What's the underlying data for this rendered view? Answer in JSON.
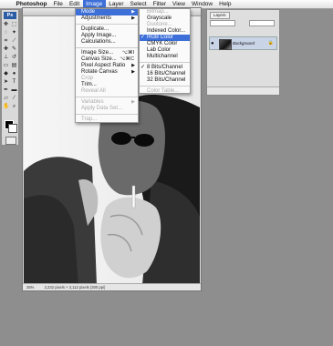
{
  "menubar": {
    "app": "Photoshop",
    "items": [
      "File",
      "Edit",
      "Image",
      "Layer",
      "Select",
      "Filter",
      "View",
      "Window",
      "Help"
    ],
    "active_item": "Image"
  },
  "tools_panel": {
    "logo": "Ps"
  },
  "image_menu": {
    "items": [
      {
        "label": "Mode",
        "submenu": true,
        "highlighted": true
      },
      {
        "label": "Adjustments",
        "submenu": true
      },
      {
        "label": "Duplicate..."
      },
      {
        "label": "Apply Image..."
      },
      {
        "label": "Calculations..."
      },
      {
        "label": "Image Size...",
        "shortcut": "⌥⌘I"
      },
      {
        "label": "Canvas Size...",
        "shortcut": "⌥⌘C"
      },
      {
        "label": "Pixel Aspect Ratio",
        "submenu": true
      },
      {
        "label": "Rotate Canvas",
        "submenu": true
      },
      {
        "label": "Crop",
        "disabled": true
      },
      {
        "label": "Trim..."
      },
      {
        "label": "Reveal All",
        "disabled": true
      },
      {
        "label": "Variables",
        "submenu": true,
        "disabled": true
      },
      {
        "label": "Apply Data Set...",
        "disabled": true
      },
      {
        "label": "Trap...",
        "disabled": true
      }
    ]
  },
  "mode_menu": {
    "items": [
      {
        "label": "Bitmap...",
        "disabled": true
      },
      {
        "label": "Grayscale"
      },
      {
        "label": "Duotone...",
        "disabled": true
      },
      {
        "label": "Indexed Color..."
      },
      {
        "label": "RGB Color",
        "checked": true,
        "highlighted": true
      },
      {
        "label": "CMYK Color"
      },
      {
        "label": "Lab Color"
      },
      {
        "label": "Multichannel"
      },
      {
        "label": "8 Bits/Channel",
        "checked": true
      },
      {
        "label": "16 Bits/Channel"
      },
      {
        "label": "32 Bits/Channel"
      },
      {
        "label": "Color Table...",
        "disabled": true
      }
    ]
  },
  "layers_panel": {
    "tab": "Layers",
    "layer_name": "Background"
  },
  "document": {
    "zoom": "25%",
    "status_info": "2,232 pixels × 3,112 pixels (300 ppi)"
  }
}
